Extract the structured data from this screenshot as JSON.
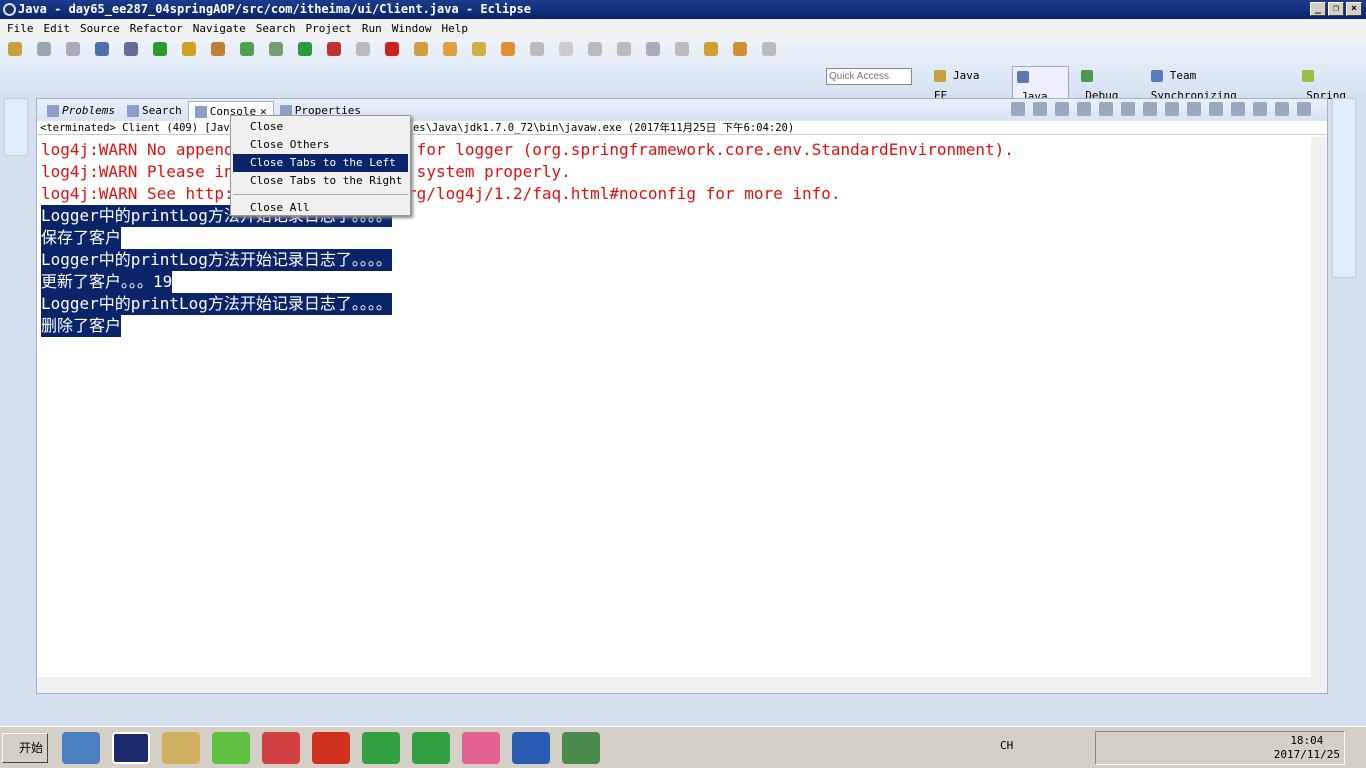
{
  "window": {
    "title": "Java - day65_ee287_04springAOP/src/com/itheima/ui/Client.java - Eclipse",
    "controls": [
      "_",
      "❐",
      "×"
    ]
  },
  "menubar": [
    "File",
    "Edit",
    "Source",
    "Refactor",
    "Navigate",
    "Search",
    "Project",
    "Run",
    "Window",
    "Help"
  ],
  "quick_access": {
    "placeholder": "Quick Access"
  },
  "perspectives": [
    {
      "label": "Java EE",
      "active": false
    },
    {
      "label": "Java",
      "active": true
    },
    {
      "label": "Debug",
      "active": false
    },
    {
      "label": "Team Synchronizing",
      "active": false
    },
    {
      "label": "Spring",
      "active": false
    }
  ],
  "view": {
    "tabs": [
      {
        "label": "Problems",
        "icon": "problems-icon"
      },
      {
        "label": "Search",
        "icon": "search-icon"
      },
      {
        "label": "Console",
        "icon": "console-icon",
        "active": true,
        "close": "✕"
      },
      {
        "label": "Properties",
        "icon": "properties-icon"
      }
    ],
    "status": "<terminated> Client (409) [Java Application] C:\\Program Files\\Java\\jdk1.7.0_72\\bin\\javaw.exe (2017年11月25日 下午6:04:20)",
    "console_lines": [
      {
        "text": "log4j:WARN No appenders could be found for logger (org.springframework.core.env.StandardEnvironment).",
        "type": "error"
      },
      {
        "text": "log4j:WARN Please initialize the log4j system properly.",
        "type": "error"
      },
      {
        "text": "log4j:WARN See http://logging.apache.org/log4j/1.2/faq.html#noconfig for more info.",
        "type": "error"
      },
      {
        "text": "Logger中的printLog方法开始记录日志了。。。。",
        "type": "selected"
      },
      {
        "text": "保存了客户",
        "type": "selected"
      },
      {
        "text": "Logger中的printLog方法开始记录日志了。。。。",
        "type": "selected"
      },
      {
        "text": "更新了客户。。。19",
        "type": "selected"
      },
      {
        "text": "Logger中的printLog方法开始记录日志了。。。。",
        "type": "selected"
      },
      {
        "text": "删除了客户",
        "type": "selected"
      }
    ]
  },
  "context_menu": {
    "items": [
      "Close",
      "Close Others",
      "Close Tabs to the Left",
      "Close Tabs to the Right",
      "Close All"
    ],
    "highlighted": "Close Tabs to the Left"
  },
  "taskbar": {
    "start": "开始",
    "lang": "CH",
    "time": "18:04",
    "date": "2017/11/25"
  },
  "colors": {
    "selection": "#0a246a",
    "error": "#e01010",
    "title": "#0a246a"
  }
}
